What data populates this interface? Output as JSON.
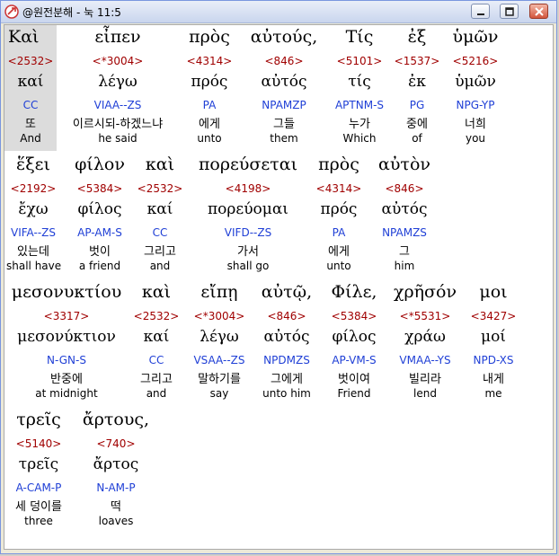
{
  "window": {
    "title": "@원전분해 - 눅 11:5",
    "controls": {
      "minimize_icon": "minimize-icon",
      "maximize_icon": "maximize-icon",
      "close_icon": "close-icon"
    }
  },
  "rows": [
    {
      "words": [
        {
          "greek": "Καὶ",
          "strong": "<2532>",
          "lexeme": "καί",
          "parse": "CC",
          "korean": "또",
          "english": "And",
          "selected": true
        },
        {
          "greek": "εἶπεν",
          "strong": "<*3004>",
          "lexeme": "λέγω",
          "parse": "VIAA--ZS",
          "korean": "이르시되-하겠느냐",
          "english": "he said"
        },
        {
          "greek": "πρὸς",
          "strong": "<4314>",
          "lexeme": "πρός",
          "parse": "PA",
          "korean": "에게",
          "english": "unto"
        },
        {
          "greek": "αὐτούς,",
          "strong": "<846>",
          "lexeme": "αὐτός",
          "parse": "NPAMZP",
          "korean": "그들",
          "english": "them"
        },
        {
          "greek": "Τίς",
          "strong": "<5101>",
          "lexeme": "τίς",
          "parse": "APTNM-S",
          "korean": "누가",
          "english": "Which"
        },
        {
          "greek": "ἐξ",
          "strong": "<1537>",
          "lexeme": "ἐκ",
          "parse": "PG",
          "korean": "중에",
          "english": "of"
        },
        {
          "greek": "ὑμῶν",
          "strong": "<5216>",
          "lexeme": "ὑμῶν",
          "parse": "NPG-YP",
          "korean": "너희",
          "english": "you"
        }
      ]
    },
    {
      "words": [
        {
          "greek": "ἕξει",
          "strong": "<2192>",
          "lexeme": "ἔχω",
          "parse": "VIFA--ZS",
          "korean": "있는데",
          "english": "shall have"
        },
        {
          "greek": "φίλον",
          "strong": "<5384>",
          "lexeme": "φίλος",
          "parse": "AP-AM-S",
          "korean": "벗이",
          "english": "a friend"
        },
        {
          "greek": "καὶ",
          "strong": "<2532>",
          "lexeme": "καί",
          "parse": "CC",
          "korean": "그리고",
          "english": "and"
        },
        {
          "greek": "πορεύσεται",
          "strong": "<4198>",
          "lexeme": "πορεύομαι",
          "parse": "VIFD--ZS",
          "korean": "가서",
          "english": "shall go"
        },
        {
          "greek": "πρὸς",
          "strong": "<4314>",
          "lexeme": "πρός",
          "parse": "PA",
          "korean": "에게",
          "english": "unto"
        },
        {
          "greek": "αὐτὸν",
          "strong": "<846>",
          "lexeme": "αὐτός",
          "parse": "NPAMZS",
          "korean": "그",
          "english": "him"
        }
      ]
    },
    {
      "words": [
        {
          "greek": "μεσονυκτίου",
          "strong": "<3317>",
          "lexeme": "μεσονύκτιον",
          "parse": "N-GN-S",
          "korean": "반중에",
          "english": "at midnight"
        },
        {
          "greek": "καὶ",
          "strong": "<2532>",
          "lexeme": "καί",
          "parse": "CC",
          "korean": "그리고",
          "english": "and"
        },
        {
          "greek": "εἴπῃ",
          "strong": "<*3004>",
          "lexeme": "λέγω",
          "parse": "VSAA--ZS",
          "korean": "말하기를",
          "english": "say"
        },
        {
          "greek": "αὐτῷ,",
          "strong": "<846>",
          "lexeme": "αὐτός",
          "parse": "NPDMZS",
          "korean": "그에게",
          "english": "unto him"
        },
        {
          "greek": "Φίλε,",
          "strong": "<5384>",
          "lexeme": "φίλος",
          "parse": "AP-VM-S",
          "korean": "벗이여",
          "english": "Friend"
        },
        {
          "greek": "χρῆσόν",
          "strong": "<*5531>",
          "lexeme": "χράω",
          "parse": "VMAA--YS",
          "korean": "빌리라",
          "english": "lend"
        },
        {
          "greek": "μοι",
          "strong": "<3427>",
          "lexeme": "μοί",
          "parse": "NPD-XS",
          "korean": "내게",
          "english": "me"
        }
      ]
    },
    {
      "words": [
        {
          "greek": "τρεῖς",
          "strong": "<5140>",
          "lexeme": "τρεῖς",
          "parse": "A-CAM-P",
          "korean": "세 덩이를",
          "english": "three"
        },
        {
          "greek": "ἄρτους,",
          "strong": "<740>",
          "lexeme": "ἄρτος",
          "parse": "N-AM-P",
          "korean": "떡",
          "english": "loaves"
        }
      ]
    }
  ]
}
